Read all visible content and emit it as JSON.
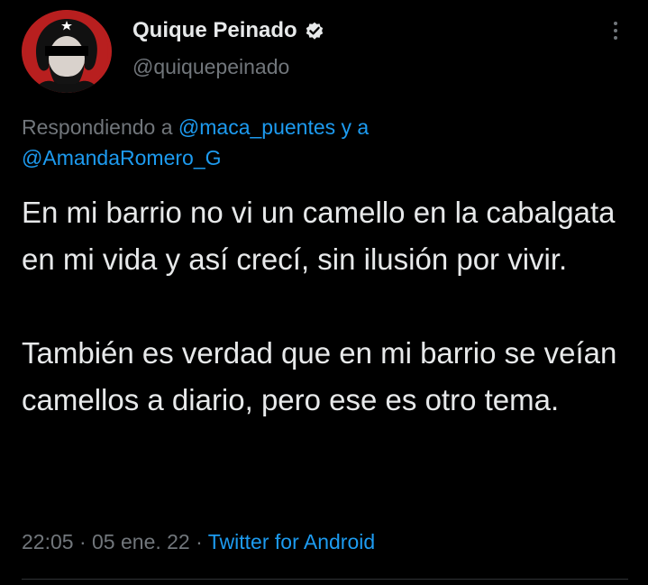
{
  "author": {
    "display_name": "Quique Peinado",
    "handle": "@quiquepeinado",
    "verified": true
  },
  "reply": {
    "prefix": "Respondiendo a",
    "mention_1": "@maca_puentes",
    "conjunction": "y a",
    "mention_2": "@AmandaRomero_G"
  },
  "tweet": {
    "paragraph_1": "En mi barrio no vi un camello en la cabalgata en mi vida y así crecí, sin ilusión por vivir.",
    "paragraph_2": "También es verdad que en mi barrio se veían camellos a diario, pero ese es otro tema."
  },
  "meta": {
    "time": "22:05",
    "separator": "·",
    "date": "05 ene. 22",
    "source": "Twitter for Android"
  },
  "icons": {
    "verified": "verified-badge-icon",
    "more": "more-options-icon"
  },
  "colors": {
    "background": "#000000",
    "text_primary": "#e7e9ea",
    "text_secondary": "#71767b",
    "accent": "#1d9bf0",
    "avatar_bg": "#b81f1f"
  }
}
